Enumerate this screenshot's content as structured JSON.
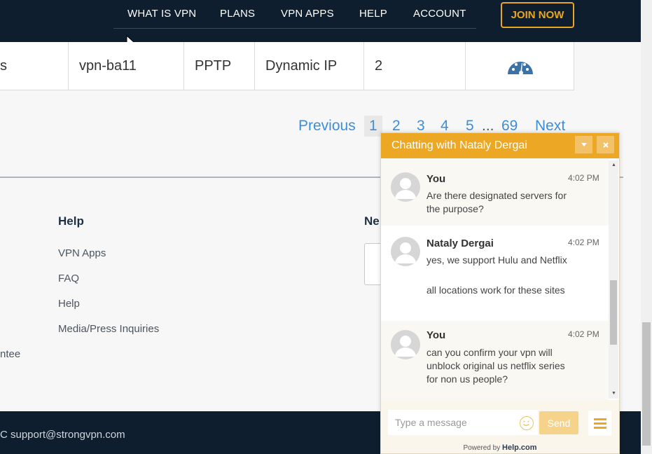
{
  "nav": {
    "items": [
      "WHAT IS VPN",
      "PLANS",
      "VPN APPS",
      "HELP",
      "ACCOUNT"
    ],
    "join_label": "JOIN NOW"
  },
  "table": {
    "cells": [
      "s",
      "vpn-ba11",
      "PPTP",
      "Dynamic IP",
      "2"
    ],
    "status_icon": "speedometer-icon"
  },
  "pagination": {
    "previous": "Previous",
    "pages": [
      "1",
      "2",
      "3",
      "4",
      "5"
    ],
    "ellipsis": "...",
    "last_page": "69",
    "next": "Next",
    "active": "1"
  },
  "footer": {
    "help_heading": "Help",
    "help_links": [
      "VPN Apps",
      "FAQ",
      "Help",
      "Media/Press Inquiries"
    ],
    "newsletter_heading_partial": "Ne",
    "guarantee_partial": "ntee",
    "support_email": "C support@strongvpn.com"
  },
  "chat": {
    "title": "Chatting with Nataly Dergai",
    "minimize_icon": "caret-down-icon",
    "close_icon": "close-icon",
    "messages": [
      {
        "author": "You",
        "time": "4:02 PM",
        "lines": [
          "Are there designated servers for the purpose?"
        ]
      },
      {
        "author": "Nataly Dergai",
        "time": "4:02 PM",
        "lines": [
          "yes, we support Hulu and Netflix",
          "all locations work for these sites"
        ]
      },
      {
        "author": "You",
        "time": "4:02 PM",
        "lines": [
          "can you confirm your vpn will unblock original us netflix series for non us people?"
        ]
      }
    ],
    "input_placeholder": "Type a message",
    "send_label": "Send",
    "powered_by": "Powered by",
    "brand": "Help.com"
  },
  "colors": {
    "navy": "#0f1e2e",
    "accent": "#eca825",
    "link": "#3d8ed6"
  }
}
